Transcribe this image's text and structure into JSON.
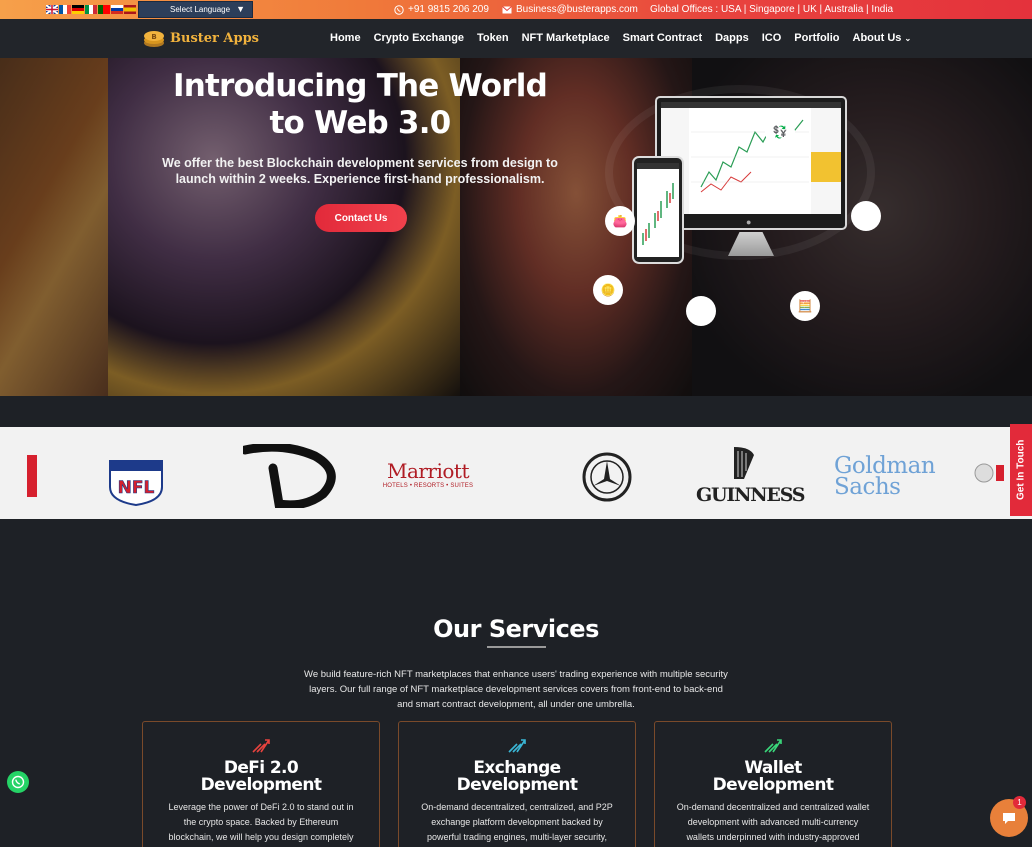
{
  "topbar": {
    "language_label": "Select Language",
    "phone": "+91 9815 206 209",
    "email": "Business@busterapps.com",
    "offices": "Global Offices : USA | Singapore | UK | Australia | India",
    "flags": [
      "en",
      "fr",
      "de",
      "it",
      "pt",
      "ru",
      "es"
    ]
  },
  "nav": {
    "logo_text": "Buster Apps",
    "items": [
      "Home",
      "Crypto Exchange",
      "Token",
      "NFT Marketplace",
      "Smart Contract",
      "Dapps",
      "ICO",
      "Portfolio",
      "About Us"
    ]
  },
  "hero": {
    "title_line1": "Introducing The World",
    "title_line2": "to Web 3.0",
    "subtitle": "We offer the best Blockchain development services from design to launch within 2 weeks. Experience first-hand professionalism.",
    "cta": "Contact Us"
  },
  "brands": [
    "NFL",
    "Marriott",
    "HOTELS • RESORTS • SUITES",
    "GUINNESS",
    "Goldman",
    "Sachs"
  ],
  "get_in_touch": "Get In Touch",
  "services": {
    "title_a": "Our",
    "title_b": "Services",
    "description": "We build feature-rich NFT marketplaces that enhance users' trading experience with multiple security layers. Our full range of NFT marketplace development services covers from front-end to back-end and smart contract development, all under one umbrella.",
    "cards": [
      {
        "title_1": "DeFi 2.0",
        "title_2": "Development",
        "text": "Leverage the power of DeFi 2.0 to stand out in the crypto space. Backed by Ethereum blockchain, we will help you design completely",
        "icon_color": "#e8433e"
      },
      {
        "title_1": "Exchange",
        "title_2": "Development",
        "text": "On-demand decentralized, centralized, and P2P exchange platform development backed by powerful trading engines, multi-layer security,",
        "icon_color": "#3ab7d6"
      },
      {
        "title_1": "Wallet",
        "title_2": "Development",
        "text": "On-demand decentralized and centralized wallet development with advanced multi-currency wallets underpinned with industry-approved",
        "icon_color": "#3ad67a"
      }
    ]
  },
  "chat_badge": "1"
}
